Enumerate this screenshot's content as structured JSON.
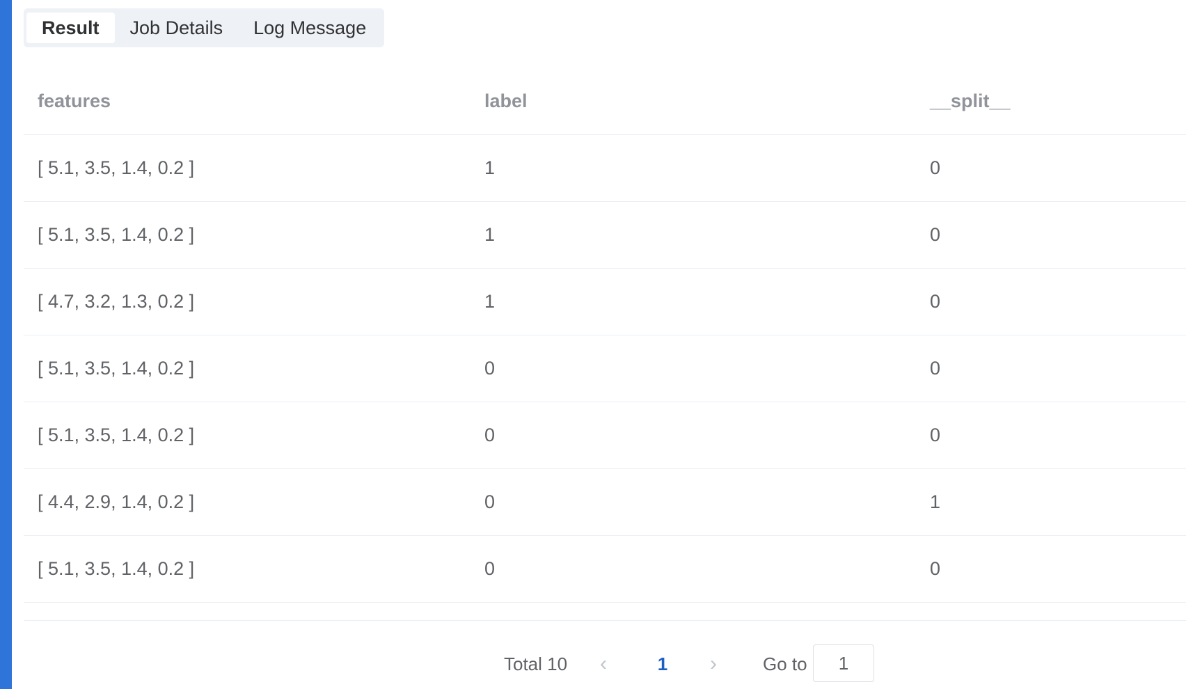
{
  "tabs": [
    {
      "label": "Result",
      "active": true
    },
    {
      "label": "Job Details",
      "active": false
    },
    {
      "label": "Log Message",
      "active": false
    }
  ],
  "table": {
    "columns": [
      "features",
      "label",
      "__split__"
    ],
    "rows": [
      [
        "[ 5.1, 3.5, 1.4, 0.2 ]",
        "1",
        "0"
      ],
      [
        "[ 5.1, 3.5, 1.4, 0.2 ]",
        "1",
        "0"
      ],
      [
        "[ 4.7, 3.2, 1.3, 0.2 ]",
        "1",
        "0"
      ],
      [
        "[ 5.1, 3.5, 1.4, 0.2 ]",
        "0",
        "0"
      ],
      [
        "[ 5.1, 3.5, 1.4, 0.2 ]",
        "0",
        "0"
      ],
      [
        "[ 4.4, 2.9, 1.4, 0.2 ]",
        "0",
        "1"
      ],
      [
        "[ 5.1, 3.5, 1.4, 0.2 ]",
        "0",
        "0"
      ]
    ]
  },
  "pagination": {
    "total_label": "Total 10",
    "prev_icon": "chevron-left-icon",
    "current_page": "1",
    "next_icon": "chevron-right-icon",
    "goto_label": "Go to",
    "goto_value": "1"
  },
  "colors": {
    "accent_bar": "#2f74d9",
    "active_page": "#1f5fc4",
    "tab_background": "#eef1f6"
  }
}
